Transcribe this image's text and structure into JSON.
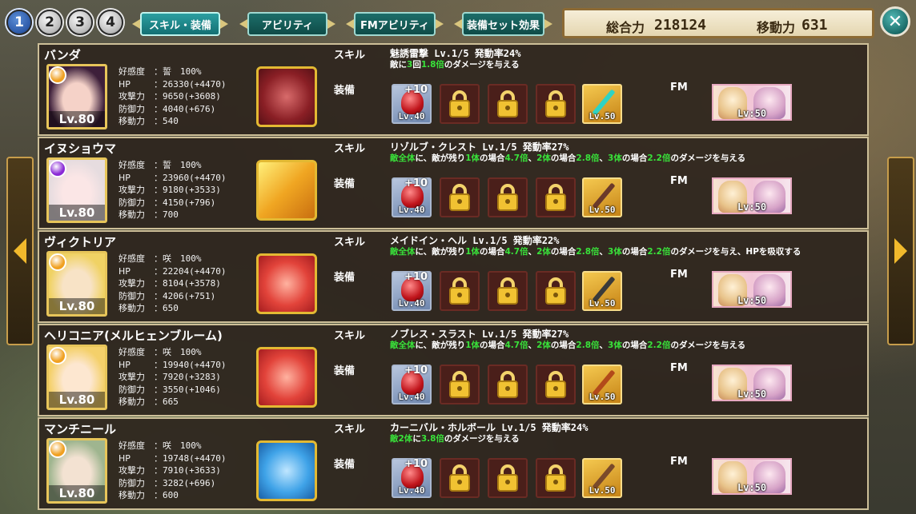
{
  "tabs": {
    "team_numbers": [
      "1",
      "2",
      "3",
      "4"
    ],
    "items": [
      "スキル・装備",
      "アビリティ",
      "FMアビリティ",
      "装備セット効果"
    ]
  },
  "totals": {
    "power_label": "総合力",
    "power_value": "218124",
    "move_label": "移動力",
    "move_value": "631"
  },
  "labels": {
    "skill": "スキル",
    "equip": "装備",
    "fm": "FM",
    "affinity": "好感度",
    "hp": "HP",
    "atk": "攻撃力",
    "def": "防御力",
    "move": "移動力"
  },
  "characters": [
    {
      "name": "バンダ",
      "level": "Lv.80",
      "affinity": "：誓　100%",
      "hp": "：26330(+4470)",
      "atk": "：9650(+3608)",
      "def": "：4040(+676)",
      "move": "：540",
      "skill_name": "魅誘雷撃 Lv.1/5 発動率24%",
      "skill_desc": [
        {
          "t": "敵に"
        },
        {
          "t": "3",
          "hl": true
        },
        {
          "t": "回"
        },
        {
          "t": "1.8倍",
          "hl": true
        },
        {
          "t": "のダメージを与える"
        }
      ],
      "gear_plus": "+10",
      "gear_lv": "Lv.40",
      "weapon_lv": "Lv.50",
      "fm_lv": "Lv:50",
      "orb_color": "#f0a020",
      "weapon_color": "#2fd3c4"
    },
    {
      "name": "イヌショウマ",
      "level": "Lv.80",
      "affinity": "：誓　100%",
      "hp": "：23960(+4470)",
      "atk": "：9180(+3533)",
      "def": "：4150(+796)",
      "move": "：700",
      "skill_name": "リゾルブ・クレスト Lv.1/5 発動率27%",
      "skill_desc": [
        {
          "t": "敵全体",
          "hl": true
        },
        {
          "t": "に、敵が残り"
        },
        {
          "t": "1体",
          "hl": true
        },
        {
          "t": "の場合"
        },
        {
          "t": "4.7倍",
          "hl": true
        },
        {
          "t": "、"
        },
        {
          "t": "2体",
          "hl": true
        },
        {
          "t": "の場合"
        },
        {
          "t": "2.8倍",
          "hl": true
        },
        {
          "t": "、"
        },
        {
          "t": "3体",
          "hl": true
        },
        {
          "t": "の場合"
        },
        {
          "t": "2.2倍",
          "hl": true
        },
        {
          "t": "のダメージを与える"
        }
      ],
      "gear_plus": "+10",
      "gear_lv": "Lv.40",
      "weapon_lv": "Lv.50",
      "fm_lv": "Lv:50",
      "orb_color": "#8a2ad6",
      "weapon_color": "#6b3a2a"
    },
    {
      "name": "ヴィクトリア",
      "level": "Lv.80",
      "affinity": "：咲　100%",
      "hp": "：22204(+4470)",
      "atk": "：8104(+3578)",
      "def": "：4206(+751)",
      "move": "：650",
      "skill_name": "メイドイン・ヘル Lv.1/5 発動率22%",
      "skill_desc": [
        {
          "t": "敵全体",
          "hl": true
        },
        {
          "t": "に、敵が残り"
        },
        {
          "t": "1体",
          "hl": true
        },
        {
          "t": "の場合"
        },
        {
          "t": "4.7倍",
          "hl": true
        },
        {
          "t": "、"
        },
        {
          "t": "2体",
          "hl": true
        },
        {
          "t": "の場合"
        },
        {
          "t": "2.8倍",
          "hl": true
        },
        {
          "t": "、"
        },
        {
          "t": "3体",
          "hl": true
        },
        {
          "t": "の場合"
        },
        {
          "t": "2.2倍",
          "hl": true
        },
        {
          "t": "のダメージを与え、HPを吸収する"
        }
      ],
      "gear_plus": "+10",
      "gear_lv": "Lv.40",
      "weapon_lv": "Lv.50",
      "fm_lv": "Lv:50",
      "orb_color": "#f0a020",
      "weapon_color": "#3a3a3a"
    },
    {
      "name": "ヘリコニア(メルヒェンブルーム)",
      "level": "Lv.80",
      "affinity": "：咲　100%",
      "hp": "：19940(+4470)",
      "atk": "：7920(+3283)",
      "def": "：3550(+1046)",
      "move": "：665",
      "skill_name": "ノブレス・スラスト Lv.1/5 発動率27%",
      "skill_desc": [
        {
          "t": "敵全体",
          "hl": true
        },
        {
          "t": "に、敵が残り"
        },
        {
          "t": "1体",
          "hl": true
        },
        {
          "t": "の場合"
        },
        {
          "t": "4.7倍",
          "hl": true
        },
        {
          "t": "、"
        },
        {
          "t": "2体",
          "hl": true
        },
        {
          "t": "の場合"
        },
        {
          "t": "2.8倍",
          "hl": true
        },
        {
          "t": "、"
        },
        {
          "t": "3体",
          "hl": true
        },
        {
          "t": "の場合"
        },
        {
          "t": "2.2倍",
          "hl": true
        },
        {
          "t": "のダメージを与える"
        }
      ],
      "gear_plus": "+10",
      "gear_lv": "Lv.40",
      "weapon_lv": "Lv.50",
      "fm_lv": "Lv:50",
      "orb_color": "#f0a020",
      "weapon_color": "#b24a1a"
    },
    {
      "name": "マンチニール",
      "level": "Lv.80",
      "affinity": "：咲　100%",
      "hp": "：19748(+4470)",
      "atk": "：7910(+3633)",
      "def": "：3282(+696)",
      "move": "：600",
      "skill_name": "カーニバル・ホルボール Lv.1/5 発動率24%",
      "skill_desc": [
        {
          "t": "敵2体",
          "hl": true
        },
        {
          "t": "に"
        },
        {
          "t": "3.8倍",
          "hl": true
        },
        {
          "t": "のダメージを与える"
        }
      ],
      "gear_plus": "+10",
      "gear_lv": "Lv.40",
      "weapon_lv": "Lv.50",
      "fm_lv": "Lv:50",
      "orb_color": "#f0a020",
      "weapon_color": "#7a4a2a"
    }
  ]
}
